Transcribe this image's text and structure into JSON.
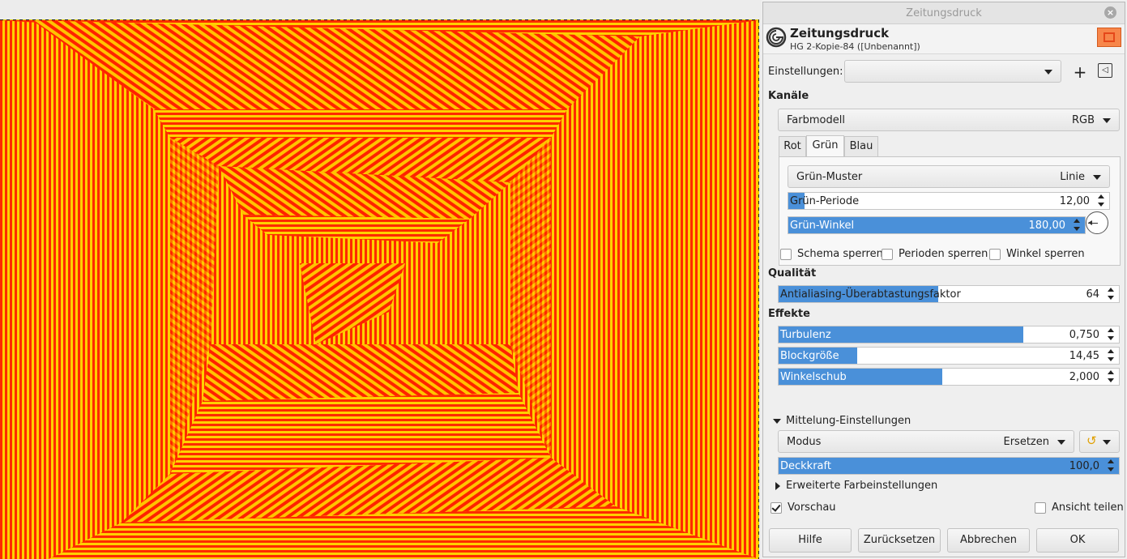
{
  "dialog": {
    "window_title": "Zeitungsdruck",
    "header_title": "Zeitungsdruck",
    "header_subtitle": "HG 2-Kopie-84 ([Unbenannt])"
  },
  "presets": {
    "label": "Einstellungen:",
    "value": ""
  },
  "channels": {
    "section": "Kanäle",
    "color_model_label": "Farbmodell",
    "color_model_value": "RGB",
    "tabs": [
      "Rot",
      "Grün",
      "Blau"
    ],
    "active_tab": "Grün",
    "pattern_label": "Grün-Muster",
    "pattern_value": "Linie",
    "period_label": "Grün-Periode",
    "period_value": "12,00",
    "period_fill": 0.05,
    "angle_label": "Grün-Winkel",
    "angle_value": "180,00",
    "angle_fill": 1.0
  },
  "locks": {
    "schema": "Schema sperren",
    "periods": "Perioden sperren",
    "angle": "Winkel sperren"
  },
  "quality": {
    "section": "Qualität",
    "aa_label": "Antialiasing-Überabtastungsfaktor",
    "aa_value": "64",
    "aa_fill": 0.47
  },
  "effects": {
    "section": "Effekte",
    "turbulence_label": "Turbulenz",
    "turbulence_value": "0,750",
    "turbulence_fill": 0.72,
    "block_label": "Blockgröße",
    "block_value": "14,45",
    "block_fill": 0.23,
    "angle_boost_label": "Winkelschub",
    "angle_boost_value": "2,000",
    "angle_boost_fill": 0.48
  },
  "blending": {
    "expander": "Mittelung-Einstellungen",
    "mode_label": "Modus",
    "mode_value": "Ersetzen",
    "opacity_label": "Deckkraft",
    "opacity_value": "100,0",
    "opacity_fill": 1.0,
    "advanced": "Erweiterte Farbeinstellungen"
  },
  "preview": {
    "label": "Vorschau",
    "checked": true,
    "split_label": "Ansicht teilen",
    "split_checked": false
  },
  "buttons": {
    "help": "Hilfe",
    "reset": "Zurücksetzen",
    "cancel": "Abbrechen",
    "ok": "OK"
  },
  "colors": {
    "accent": "#4a90d9",
    "pattern_red": "#ff2a00",
    "pattern_yellow": "#ffd000"
  },
  "icons": {
    "close": "close-icon",
    "add_preset": "plus-icon",
    "preset_menu": "menu-icon",
    "reset_mode": "reset-icon"
  }
}
